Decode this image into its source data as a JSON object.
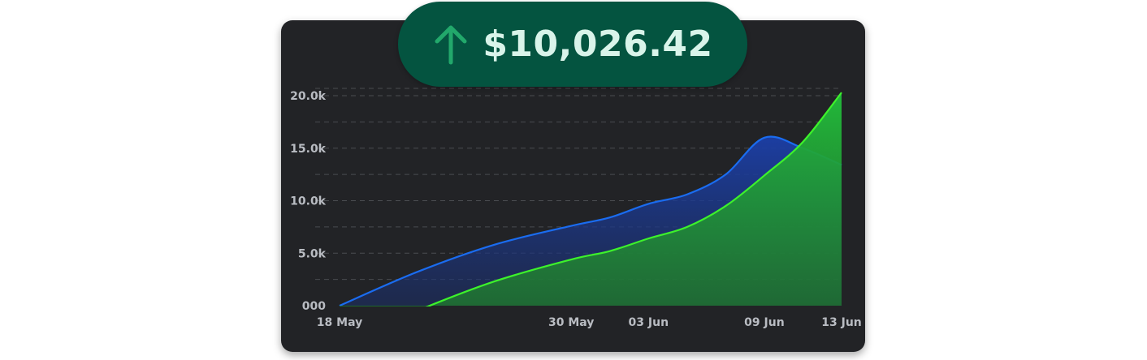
{
  "balance": {
    "amount": "$10,026.42",
    "trend_icon": "arrow-up-icon",
    "trend_color": "#22a86b"
  },
  "colors": {
    "card_bg": "#222326",
    "pill_bg": "#045440",
    "blue_series": "#1a6cf0",
    "green_series": "#3df22b",
    "grid": "#4a4c50"
  },
  "chart_data": {
    "type": "area",
    "x_tick_labels": [
      "18 May",
      "30 May",
      "03 Jun",
      "09 Jun",
      "13 Jun"
    ],
    "x_tick_dates": [
      "2024-05-18",
      "2024-05-30",
      "2024-06-03",
      "2024-06-09",
      "2024-06-13"
    ],
    "y_tick_labels": [
      "000",
      "5.0k",
      "10.0k",
      "15.0k",
      "20.0k"
    ],
    "y_tick_values": [
      0,
      5000,
      10000,
      15000,
      20000
    ],
    "ylim": [
      0,
      20000
    ],
    "xlim": [
      "2024-05-18",
      "2024-06-13"
    ],
    "grid": true,
    "series": [
      {
        "color": "#1a6cf0",
        "x": [
          "2024-05-18",
          "2024-05-22",
          "2024-05-26",
          "2024-05-30",
          "2024-06-01",
          "2024-06-03",
          "2024-06-05",
          "2024-06-07",
          "2024-06-09",
          "2024-06-11",
          "2024-06-13"
        ],
        "values": [
          0,
          3200,
          5800,
          7600,
          8400,
          9700,
          10600,
          12500,
          16000,
          15000,
          13400
        ]
      },
      {
        "color": "#3df22b",
        "x": [
          "2024-05-18",
          "2024-05-22",
          "2024-05-26",
          "2024-05-30",
          "2024-06-01",
          "2024-06-03",
          "2024-06-05",
          "2024-06-07",
          "2024-06-09",
          "2024-06-11",
          "2024-06-13"
        ],
        "values": [
          -3700,
          -500,
          2300,
          4400,
          5200,
          6400,
          7500,
          9500,
          12400,
          15600,
          20300
        ]
      }
    ]
  }
}
